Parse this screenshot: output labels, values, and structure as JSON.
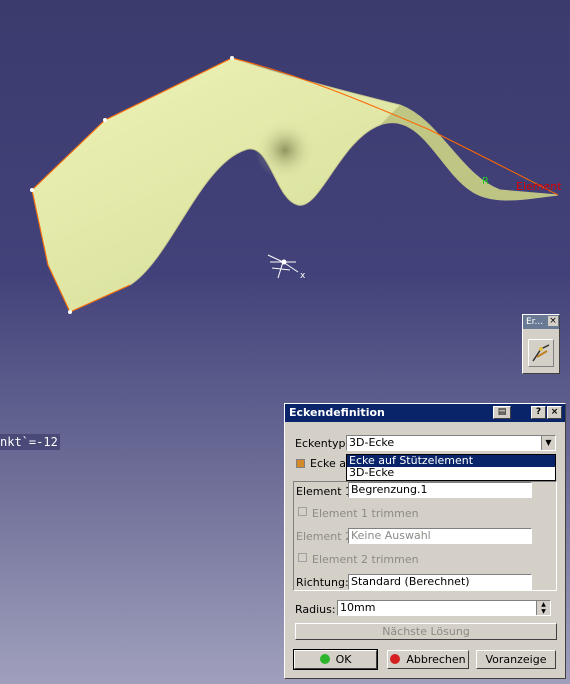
{
  "viewport": {
    "parameter_label": "nkt`=-12",
    "surface_label": "Element",
    "radius_marker": "R"
  },
  "mini_toolbar": {
    "title": "Er...",
    "close_label": "×",
    "button_icon": "corner-tool-icon"
  },
  "dialog": {
    "title": "Eckendefinition",
    "title_buttons": {
      "icon": "window-icon",
      "help": "?",
      "close": "×"
    },
    "corner_type_label": "Eckentyp:",
    "corner_type_value": "3D-Ecke",
    "dropdown_options": [
      "Ecke auf Stützelement",
      "3D-Ecke"
    ],
    "dropdown_selected_index": 0,
    "support_checkbox_label": "Ecke au",
    "element1_label": "Element 1:",
    "element1_value": "Begrenzung.1",
    "trim1_label": "Element 1 trimmen",
    "element2_label": "Element 2:",
    "element2_value": "Keine Auswahl",
    "trim2_label": "Element 2 trimmen",
    "direction_label": "Richtung:",
    "direction_value": "Standard (Berechnet)",
    "radius_label": "Radius:",
    "radius_value": "10mm",
    "next_solution_label": "Nächste Lösung",
    "ok_label": "OK",
    "cancel_label": "Abbrechen",
    "preview_label": "Voranzeige",
    "colors": {
      "title_bar": "#0a246a",
      "ok_dot": "#2bb52b",
      "cancel_dot": "#d42020",
      "checkbox": "#d48a2a"
    }
  }
}
